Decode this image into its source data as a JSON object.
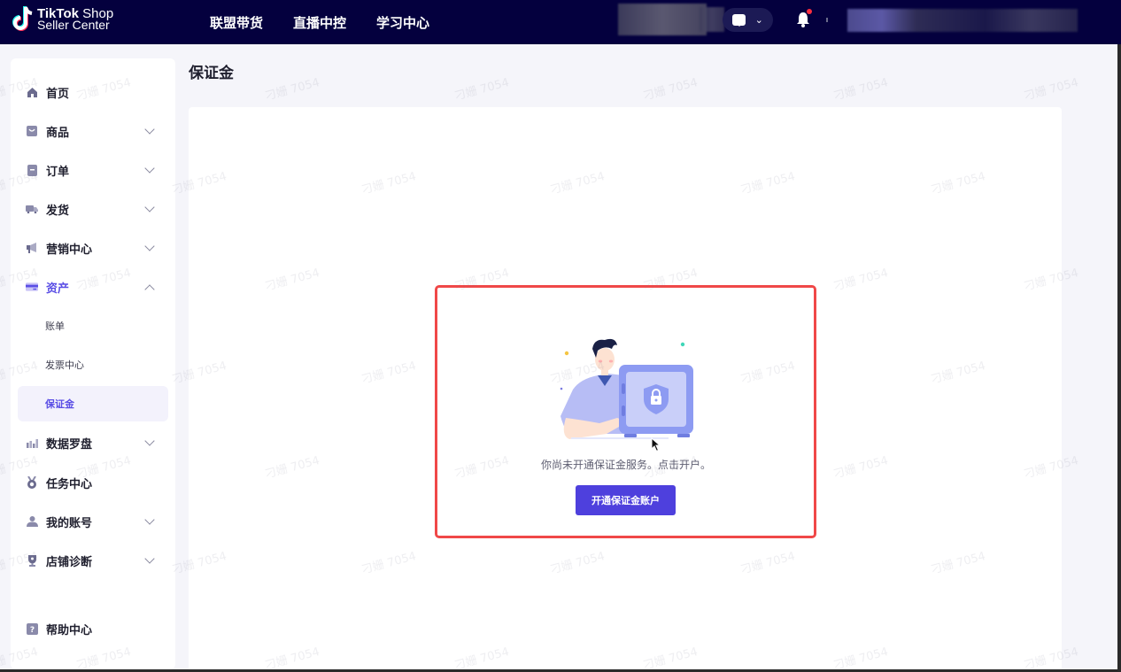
{
  "header": {
    "logo_line1_bold": "TikTok",
    "logo_line1_rest": " Shop",
    "logo_line2": "Seller Center",
    "nav": [
      "联盟带货",
      "直播中控",
      "学习中心"
    ],
    "icons": {
      "messages": "message-icon",
      "dropdown": "chevron-down-icon",
      "notifications": "bell-icon"
    },
    "notification_dot_color": "#ff2e3e"
  },
  "sidebar": {
    "items": [
      {
        "label": "首页",
        "icon": "home-icon",
        "expandable": false
      },
      {
        "label": "商品",
        "icon": "product-icon",
        "expandable": true
      },
      {
        "label": "订单",
        "icon": "order-icon",
        "expandable": true
      },
      {
        "label": "发货",
        "icon": "truck-icon",
        "expandable": true
      },
      {
        "label": "营销中心",
        "icon": "megaphone-icon",
        "expandable": true
      },
      {
        "label": "资产",
        "icon": "card-icon",
        "expandable": true,
        "expanded": true,
        "active": true,
        "children": [
          {
            "label": "账单"
          },
          {
            "label": "发票中心"
          },
          {
            "label": "保证金",
            "selected": true
          }
        ]
      },
      {
        "label": "数据罗盘",
        "icon": "chart-icon",
        "expandable": true
      },
      {
        "label": "任务中心",
        "icon": "medal-icon",
        "expandable": false
      },
      {
        "label": "我的账号",
        "icon": "user-icon",
        "expandable": true
      },
      {
        "label": "店铺诊断",
        "icon": "trophy-icon",
        "expandable": true
      }
    ],
    "help": {
      "label": "帮助中心",
      "icon": "help-icon"
    }
  },
  "main": {
    "title": "保证金",
    "empty_state": {
      "message": "你尚未开通保证金服务。点击开户。",
      "button_label": "开通保证金账户",
      "illustration": "person-with-safe-illustration"
    }
  },
  "watermark": "刁姗 7054",
  "colors": {
    "topbar": "#04003e",
    "accent": "#5a4ee5",
    "button": "#4e40dd",
    "highlight_border": "#f04848"
  }
}
